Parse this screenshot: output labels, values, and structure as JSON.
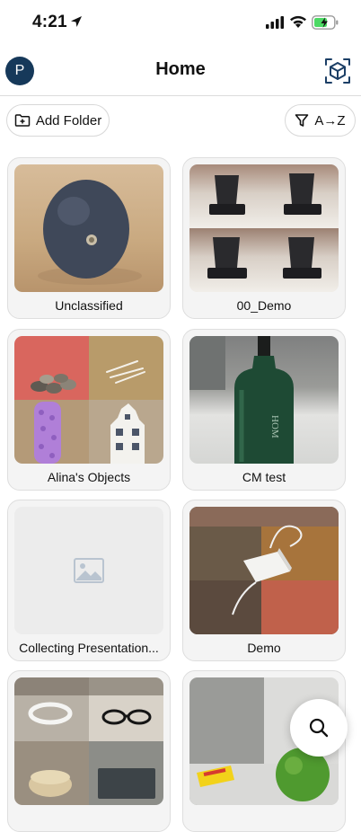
{
  "status_bar": {
    "time": "4:21"
  },
  "header": {
    "avatar_letter": "P",
    "title": "Home"
  },
  "toolbar": {
    "add_folder_label": "Add Folder",
    "sort_label": "A→Z"
  },
  "folders": [
    {
      "name": "Unclassified"
    },
    {
      "name": "00_Demo"
    },
    {
      "name": "Alina's Objects"
    },
    {
      "name": "CM test"
    },
    {
      "name": "Collecting Presentation..."
    },
    {
      "name": "Demo"
    },
    {
      "name": ""
    },
    {
      "name": ""
    }
  ],
  "colors": {
    "brand": "#16395a",
    "card_bg": "#f4f4f4",
    "placeholder_icon": "#b9c4d0"
  },
  "icons": {
    "search": "search-icon",
    "ar": "ar-cube-icon"
  }
}
